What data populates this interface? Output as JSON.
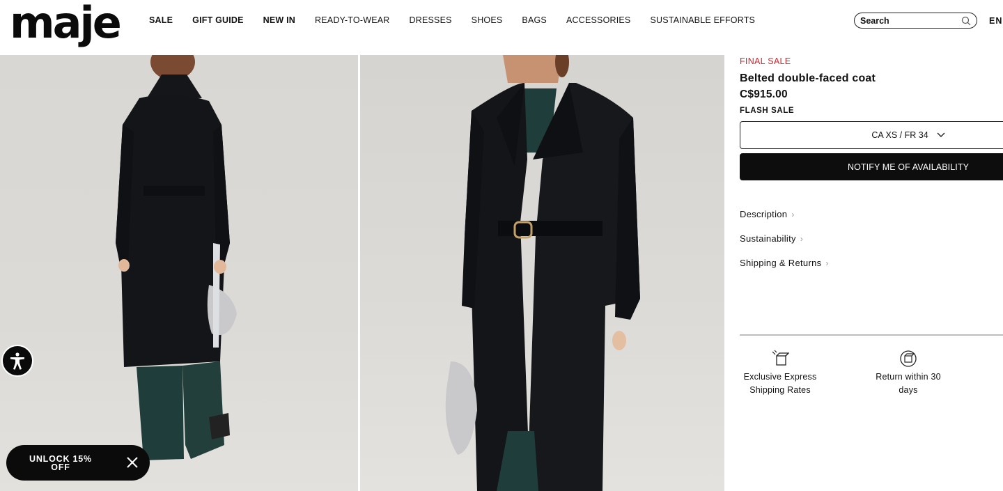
{
  "header": {
    "logo": "maje",
    "nav": [
      {
        "label": "SALE",
        "bold": true
      },
      {
        "label": "GIFT GUIDE",
        "bold": true
      },
      {
        "label": "NEW IN",
        "bold": true
      },
      {
        "label": "READY-TO-WEAR",
        "bold": false
      },
      {
        "label": "DRESSES",
        "bold": false
      },
      {
        "label": "SHOES",
        "bold": false
      },
      {
        "label": "BAGS",
        "bold": false
      },
      {
        "label": "ACCESSORIES",
        "bold": false
      },
      {
        "label": "SUSTAINABLE EFFORTS",
        "bold": false
      }
    ],
    "search_label": "Search",
    "language": "EN"
  },
  "product": {
    "sale_badge": "FINAL SALE",
    "title": "Belted double-faced coat",
    "price": "C$915.00",
    "flash_label": "FLASH SALE",
    "size_selected": "CA XS / FR 34",
    "notify_button": "NOTIFY ME OF AVAILABILITY",
    "accordion": [
      "Description",
      "Sustainability",
      "Shipping & Returns"
    ],
    "perks": [
      {
        "line1": "Exclusive Express",
        "line2": "Shipping Rates",
        "icon": "box-shipping-icon"
      },
      {
        "line1": "Return within 30",
        "line2": "days",
        "icon": "return-box-icon"
      }
    ]
  },
  "promo": {
    "unlock_line1": "UNLOCK 15%",
    "unlock_line2": "OFF"
  },
  "colors": {
    "sale_red": "#d2262f",
    "primary_black": "#0d0d0d",
    "coat": "#141519",
    "tweed": "#1f3d3a"
  }
}
